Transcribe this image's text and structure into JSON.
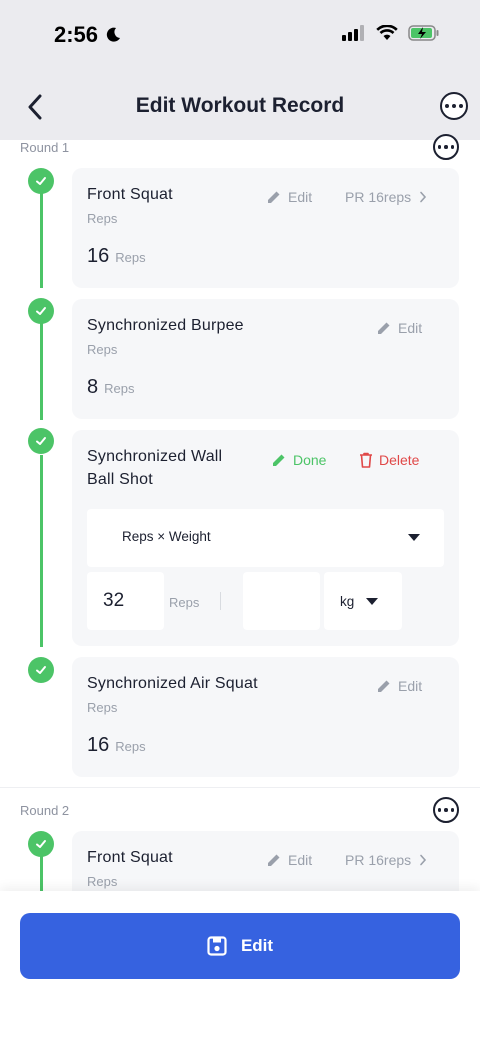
{
  "status": {
    "time": "2:56"
  },
  "nav": {
    "title": "Edit Workout Record"
  },
  "rounds": [
    {
      "label": "Round 1"
    },
    {
      "label": "Round 2"
    }
  ],
  "exercises": [
    {
      "name": "Front Squat",
      "type": "Reps",
      "value": "16",
      "unit": "Reps",
      "edit": "Edit",
      "pr": "PR 16reps"
    },
    {
      "name": "Synchronized Burpee",
      "type": "Reps",
      "value": "8",
      "unit": "Reps",
      "edit": "Edit"
    },
    {
      "name_line1": "Synchronized Wall",
      "name_line2": "Ball Shot",
      "done": "Done",
      "delete": "Delete",
      "mode": "Reps × Weight",
      "reps_value": "32",
      "reps_unit": "Reps",
      "weight_value": "",
      "weight_unit": "kg"
    },
    {
      "name": "Synchronized Air Squat",
      "type": "Reps",
      "value": "16",
      "unit": "Reps",
      "edit": "Edit"
    },
    {
      "name": "Front Squat",
      "type": "Reps",
      "edit": "Edit",
      "pr": "PR 16reps"
    }
  ],
  "footer": {
    "button_label": "Edit"
  },
  "colors": {
    "accent": "#3662e0",
    "success": "#4cc467",
    "danger": "#e04848"
  }
}
